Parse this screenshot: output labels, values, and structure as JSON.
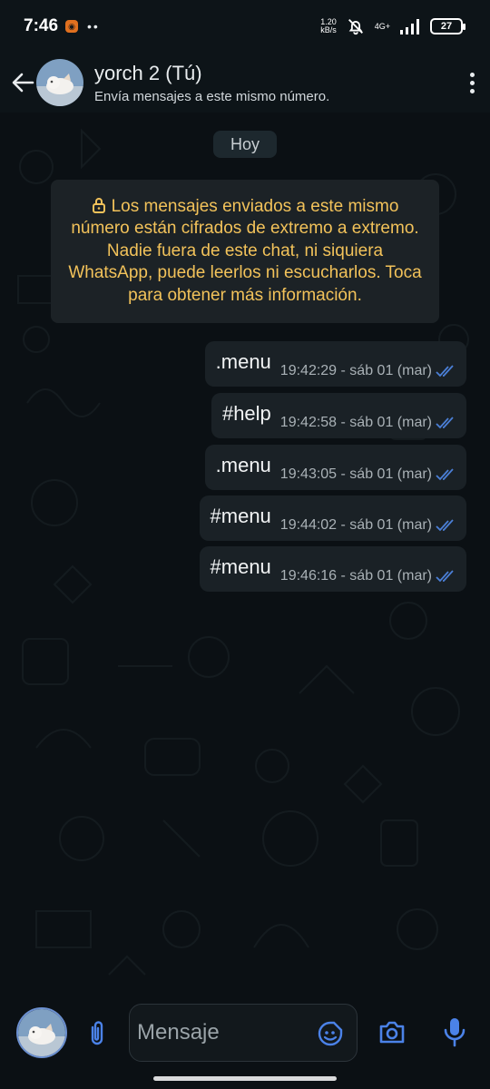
{
  "status_bar": {
    "time": "7:46",
    "net_speed_value": "1.20",
    "net_speed_unit": "kB/s",
    "network": "4G+",
    "battery": "27"
  },
  "header": {
    "contact_name": "yorch 2 (Tú)",
    "subtitle": "Envía mensajes a este mismo número."
  },
  "chat": {
    "date_label": "Hoy",
    "encryption_notice": "Los mensajes enviados a este mismo número están cifrados de extremo a extremo. Nadie fuera de este chat, ni siquiera WhatsApp, puede leerlos ni escucharlos. Toca para obtener más información.",
    "messages": [
      {
        "text": ".menu",
        "timestamp": "19:42:29 - sáb 01 (mar)"
      },
      {
        "text": "#help",
        "timestamp": "19:42:58 - sáb 01 (mar)"
      },
      {
        "text": ".menu",
        "timestamp": "19:43:05 - sáb 01 (mar)"
      },
      {
        "text": "#menu",
        "timestamp": "19:44:02 - sáb 01 (mar)"
      },
      {
        "text": "#menu",
        "timestamp": "19:46:16 - sáb 01 (mar)"
      }
    ]
  },
  "input_bar": {
    "placeholder": "Mensaje"
  },
  "colors": {
    "background": "#0b1014",
    "bubble": "#1a2126",
    "notice_text": "#f2c25a",
    "tick_blue": "#53bdeb",
    "accent_icons": "#4b82e8"
  },
  "icons": [
    "back-arrow-icon",
    "more-options-icon",
    "lock-icon",
    "double-check-icon",
    "attach-icon",
    "sticker-icon",
    "camera-icon",
    "mic-icon"
  ]
}
